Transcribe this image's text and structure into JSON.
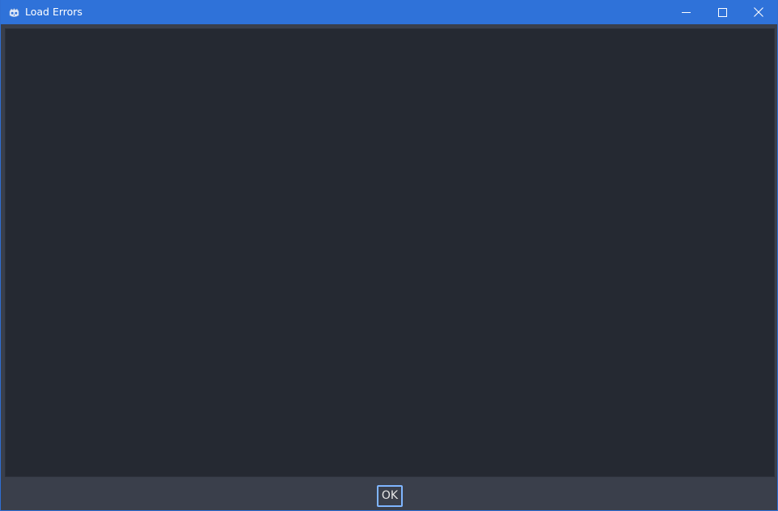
{
  "window": {
    "title": "Load Errors",
    "accent": "#2f72d9"
  },
  "icons": {
    "app": "godot-engine-icon",
    "minimize": "minimize-icon",
    "maximize": "maximize-icon",
    "close": "close-icon"
  },
  "dialog": {
    "ok_label": "OK"
  },
  "colors": {
    "content_bg": "#252932",
    "panel_bg": "#3a3f4b",
    "focus_border": "#7fb5ff"
  }
}
